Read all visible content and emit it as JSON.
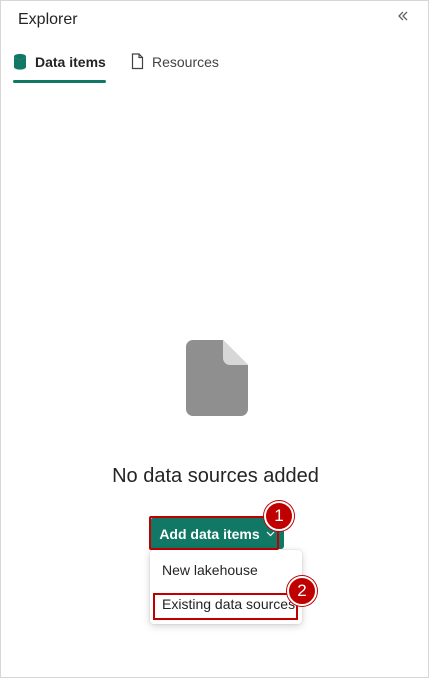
{
  "panel": {
    "title": "Explorer",
    "collapse_icon": "double-chevron-left-icon"
  },
  "tabs": [
    {
      "label": "Data items",
      "icon": "database-icon",
      "selected": true
    },
    {
      "label": "Resources",
      "icon": "document-icon",
      "selected": false
    }
  ],
  "empty_state": {
    "icon": "blank-file-icon",
    "message": "No data sources added"
  },
  "add_button": {
    "label": "Add data items",
    "icon": "chevron-down-icon"
  },
  "menu": {
    "items": [
      {
        "label": "New lakehouse"
      },
      {
        "label": "Existing data sources"
      }
    ]
  },
  "annotations": {
    "step1": "1",
    "step2": "2"
  },
  "colors": {
    "accent": "#117865",
    "highlight": "#c00000"
  }
}
